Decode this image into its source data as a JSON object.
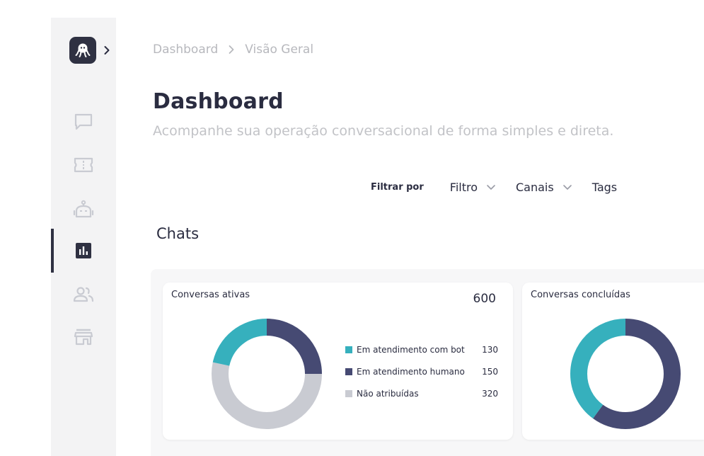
{
  "sidebar": {
    "items": [
      {
        "icon": "chat-icon",
        "active": false
      },
      {
        "icon": "ticket-icon",
        "active": false
      },
      {
        "icon": "bot-icon",
        "active": false
      },
      {
        "icon": "analytics-icon",
        "active": true
      },
      {
        "icon": "users-icon",
        "active": false
      },
      {
        "icon": "store-icon",
        "active": false
      }
    ]
  },
  "breadcrumb": {
    "root": "Dashboard",
    "current": "Visão Geral"
  },
  "header": {
    "title": "Dashboard",
    "subtitle": "Acompanhe sua operação conversacional de forma simples e direta."
  },
  "filters": {
    "label": "Filtrar por",
    "options": [
      "Filtro",
      "Canais",
      "Tags"
    ]
  },
  "section_title": "Chats",
  "colors": {
    "teal": "#36b0bd",
    "navy": "#464a73",
    "gray": "#c9cbd2",
    "dark": "#2f3142"
  },
  "cards": {
    "active": {
      "title": "Conversas ativas",
      "total": "600",
      "legend": [
        {
          "label": "Em atendimento com bot",
          "value": "130",
          "color": "#36b0bd"
        },
        {
          "label": "Em atendimento humano",
          "value": "150",
          "color": "#464a73"
        },
        {
          "label": "Não atribuídas",
          "value": "320",
          "color": "#c9cbd2"
        }
      ]
    },
    "completed": {
      "title": "Conversas concluídas",
      "segments": [
        {
          "fraction": 0.6,
          "color": "#464a73"
        },
        {
          "fraction": 0.4,
          "color": "#36b0bd"
        }
      ]
    }
  },
  "chart_data": [
    {
      "type": "pie",
      "title": "Conversas ativas",
      "categories": [
        "Em atendimento com bot",
        "Em atendimento humano",
        "Não atribuídas"
      ],
      "values": [
        130,
        150,
        320
      ]
    },
    {
      "type": "pie",
      "title": "Conversas concluídas",
      "categories": [
        "",
        ""
      ],
      "values": [
        0.6,
        0.4
      ]
    }
  ]
}
